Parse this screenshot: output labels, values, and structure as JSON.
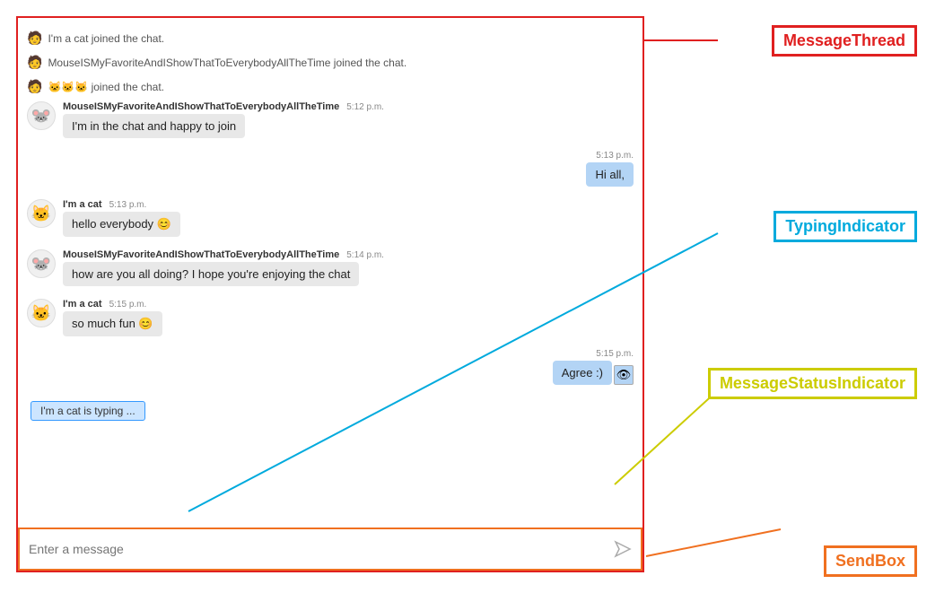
{
  "chat": {
    "system_messages": [
      {
        "text": "I'm a cat joined the chat."
      },
      {
        "text": "MouseISMyFavoriteAndIShowThatToEverybodyAllTheTime joined the chat."
      },
      {
        "text": "🐱🐱🐱 joined the chat."
      }
    ],
    "messages": [
      {
        "id": "msg1",
        "type": "incoming",
        "sender": "MouseISMyFavoriteAndIShowThatToEverybodyAllTheTime",
        "time": "5:12 p.m.",
        "text": "I'm in the chat and happy to join",
        "avatar": "🐭"
      },
      {
        "id": "msg2",
        "type": "outgoing",
        "time": "5:13 p.m.",
        "text": "Hi all,"
      },
      {
        "id": "msg3",
        "type": "incoming",
        "sender": "I'm a cat",
        "time": "5:13 p.m.",
        "text": "hello everybody 😊",
        "avatar": "🐱"
      },
      {
        "id": "msg4",
        "type": "incoming",
        "sender": "MouseISMyFavoriteAndIShowThatToEverybodyAllTheTime",
        "time": "5:14 p.m.",
        "text": "how are you all doing? I hope you're enjoying the chat",
        "avatar": "🐭"
      },
      {
        "id": "msg5",
        "type": "incoming",
        "sender": "I'm a cat",
        "time": "5:15 p.m.",
        "text": "so much fun 😊",
        "avatar": "🐱"
      },
      {
        "id": "msg6",
        "type": "outgoing",
        "time": "5:15 p.m.",
        "text": "Agree :)",
        "has_status": true,
        "status_icon": "👁"
      }
    ],
    "typing_indicator": "I'm a cat is typing ...",
    "sendbox_placeholder": "Enter a message"
  },
  "labels": {
    "message_thread": "MessageThread",
    "typing_indicator": "TypingIndicator",
    "message_status": "MessageStatusIndicator",
    "sendbox": "SendBox"
  }
}
